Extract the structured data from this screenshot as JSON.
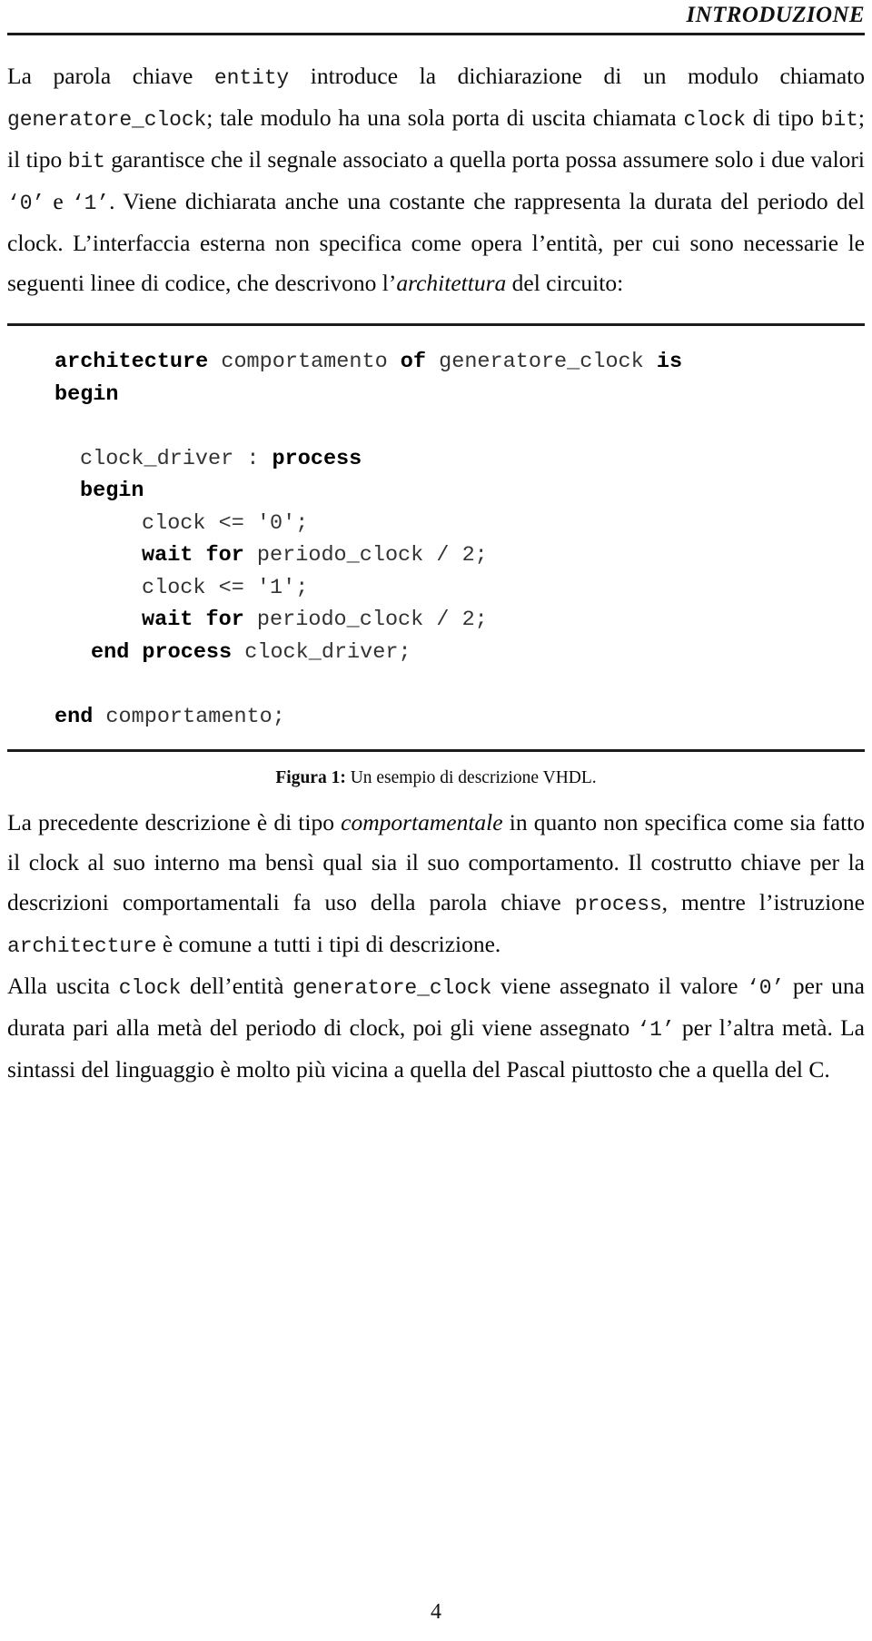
{
  "header": {
    "running_title": "INTRODUZIONE"
  },
  "body": {
    "paragraph_1": {
      "segments": [
        {
          "text": "La parola chiave ",
          "style": "serif"
        },
        {
          "text": "entity",
          "style": "mono"
        },
        {
          "text": " introduce la dichiarazione di un modulo chiamato ",
          "style": "serif"
        },
        {
          "text": "generatore_clock",
          "style": "mono"
        },
        {
          "text": "; tale modulo ha una sola porta di uscita chiamata ",
          "style": "serif"
        },
        {
          "text": "clock",
          "style": "mono"
        },
        {
          "text": " di tipo ",
          "style": "serif"
        },
        {
          "text": "bit",
          "style": "mono"
        },
        {
          "text": "; il tipo ",
          "style": "serif"
        },
        {
          "text": "bit",
          "style": "mono"
        },
        {
          "text": " garantisce che il segnale associato a quella porta possa assumere solo i due valori ",
          "style": "serif"
        },
        {
          "text": "‘0’",
          "style": "mono"
        },
        {
          "text": " e ",
          "style": "serif"
        },
        {
          "text": "‘1’",
          "style": "mono"
        },
        {
          "text": ". Viene dichiarata anche una costante che rappresenta la durata del periodo del clock. L’interfaccia esterna non specifica come opera l’entità, per cui sono necessarie le seguenti linee di codice, che descrivono l’",
          "style": "serif"
        },
        {
          "text": "architettura",
          "style": "italic"
        },
        {
          "text": " del circuito:",
          "style": "serif"
        }
      ]
    },
    "paragraph_2": {
      "segments": [
        {
          "text": "La precedente descrizione è di tipo ",
          "style": "serif"
        },
        {
          "text": "comportamentale",
          "style": "italic"
        },
        {
          "text": " in quanto non specifica come sia fatto il clock al suo interno ma bensì qual sia il suo comportamento. Il costrutto chiave per la descrizioni comportamentali fa uso della parola chiave ",
          "style": "serif"
        },
        {
          "text": "process",
          "style": "mono"
        },
        {
          "text": ", mentre l’istruzione ",
          "style": "serif"
        },
        {
          "text": "architecture",
          "style": "mono"
        },
        {
          "text": " è comune a tutti i tipi di descrizione.",
          "style": "serif"
        }
      ]
    },
    "paragraph_3": {
      "segments": [
        {
          "text": "Alla uscita ",
          "style": "serif"
        },
        {
          "text": "clock",
          "style": "mono"
        },
        {
          "text": " dell’entità ",
          "style": "serif"
        },
        {
          "text": "generatore_clock",
          "style": "mono"
        },
        {
          "text": " viene assegnato il valore ",
          "style": "serif"
        },
        {
          "text": "‘0’",
          "style": "mono"
        },
        {
          "text": " per una durata pari alla metà del periodo di clock, poi gli viene assegnato ",
          "style": "serif"
        },
        {
          "text": "‘1’",
          "style": "mono"
        },
        {
          "text": " per l’altra metà. La sintassi del linguaggio è molto più vicina a quella del Pascal piuttosto che a quella del C.",
          "style": "serif"
        }
      ]
    }
  },
  "figure": {
    "code_lines": [
      {
        "indent": 0,
        "tokens": [
          {
            "text": "architecture",
            "kind": "kw"
          },
          {
            "text": " ",
            "kind": "id"
          },
          {
            "text": "comportamento",
            "kind": "id"
          },
          {
            "text": " ",
            "kind": "id"
          },
          {
            "text": "of",
            "kind": "kw"
          },
          {
            "text": " ",
            "kind": "id"
          },
          {
            "text": "generatore_clock",
            "kind": "id"
          },
          {
            "text": " ",
            "kind": "id"
          },
          {
            "text": "is",
            "kind": "kw"
          }
        ]
      },
      {
        "indent": 0,
        "tokens": [
          {
            "text": "begin",
            "kind": "kw"
          }
        ]
      },
      {
        "indent": 0,
        "blank": true,
        "tokens": []
      },
      {
        "indent": 1,
        "tokens": [
          {
            "text": "clock_driver",
            "kind": "id"
          },
          {
            "text": " : ",
            "kind": "id"
          },
          {
            "text": "process",
            "kind": "kw"
          }
        ]
      },
      {
        "indent": 1,
        "tokens": [
          {
            "text": "begin",
            "kind": "kw"
          }
        ]
      },
      {
        "indent": 2,
        "tokens": [
          {
            "text": "clock <= '0';",
            "kind": "id"
          }
        ]
      },
      {
        "indent": 2,
        "tokens": [
          {
            "text": "wait for",
            "kind": "kw"
          },
          {
            "text": " periodo_clock / 2;",
            "kind": "id"
          }
        ]
      },
      {
        "indent": 2,
        "tokens": [
          {
            "text": "clock <= '1';",
            "kind": "id"
          }
        ]
      },
      {
        "indent": 2,
        "tokens": [
          {
            "text": "wait for",
            "kind": "kw"
          },
          {
            "text": " periodo_clock / 2;",
            "kind": "id"
          }
        ]
      },
      {
        "indent": 1,
        "tokens": [
          {
            "text": "end process",
            "kind": "kw"
          },
          {
            "text": " clock_driver;",
            "kind": "id"
          }
        ]
      },
      {
        "indent": 0,
        "blank": true,
        "tokens": []
      },
      {
        "indent": 0,
        "tokens": [
          {
            "text": "end",
            "kind": "kw"
          },
          {
            "text": " comportamento;",
            "kind": "id"
          }
        ]
      }
    ],
    "caption_label": "Figura 1:",
    "caption_text": " Un esempio di descrizione VHDL."
  },
  "footer": {
    "page_number": "4"
  }
}
